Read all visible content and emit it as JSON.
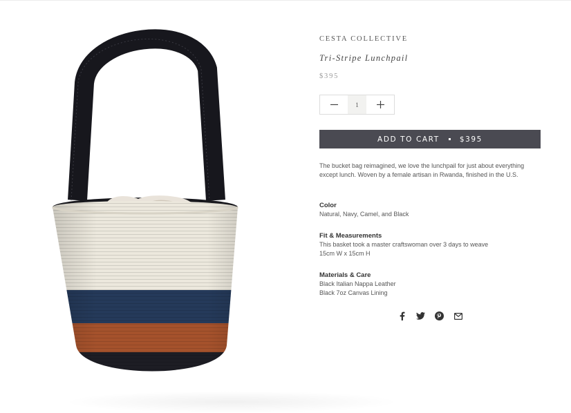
{
  "product": {
    "vendor": "CESTA COLLECTIVE",
    "title": "Tri-Stripe Lunchpail",
    "price": "$395",
    "quantity": "1",
    "add_to_cart_label": "ADD TO CART",
    "add_to_cart_price": "$395",
    "description": "The bucket bag reimagined, we love the lunchpail for just about everything except lunch. Woven by a female artisan in Rwanda, finished in the U.S."
  },
  "details": {
    "color": {
      "title": "Color",
      "lines": [
        "Natural, Navy, Camel, and Black"
      ]
    },
    "fit": {
      "title": "Fit & Measurements",
      "lines": [
        "This basket took a master craftswoman over 3 days to weave",
        "15cm W x 15cm H"
      ]
    },
    "materials": {
      "title": "Materials & Care",
      "lines": [
        "Black Italian Nappa Leather",
        "Black 7oz Canvas Lining"
      ]
    }
  },
  "icons": {
    "qty_minus": "minus-icon",
    "qty_plus": "plus-icon",
    "share": [
      "facebook-icon",
      "twitter-icon",
      "pinterest-icon",
      "email-icon"
    ]
  },
  "colors": {
    "button_bg": "#4a4a52",
    "band_cream": "#ece8dd",
    "band_navy": "#253a5a",
    "band_camel": "#a5522c",
    "band_black": "#1d1d24"
  }
}
